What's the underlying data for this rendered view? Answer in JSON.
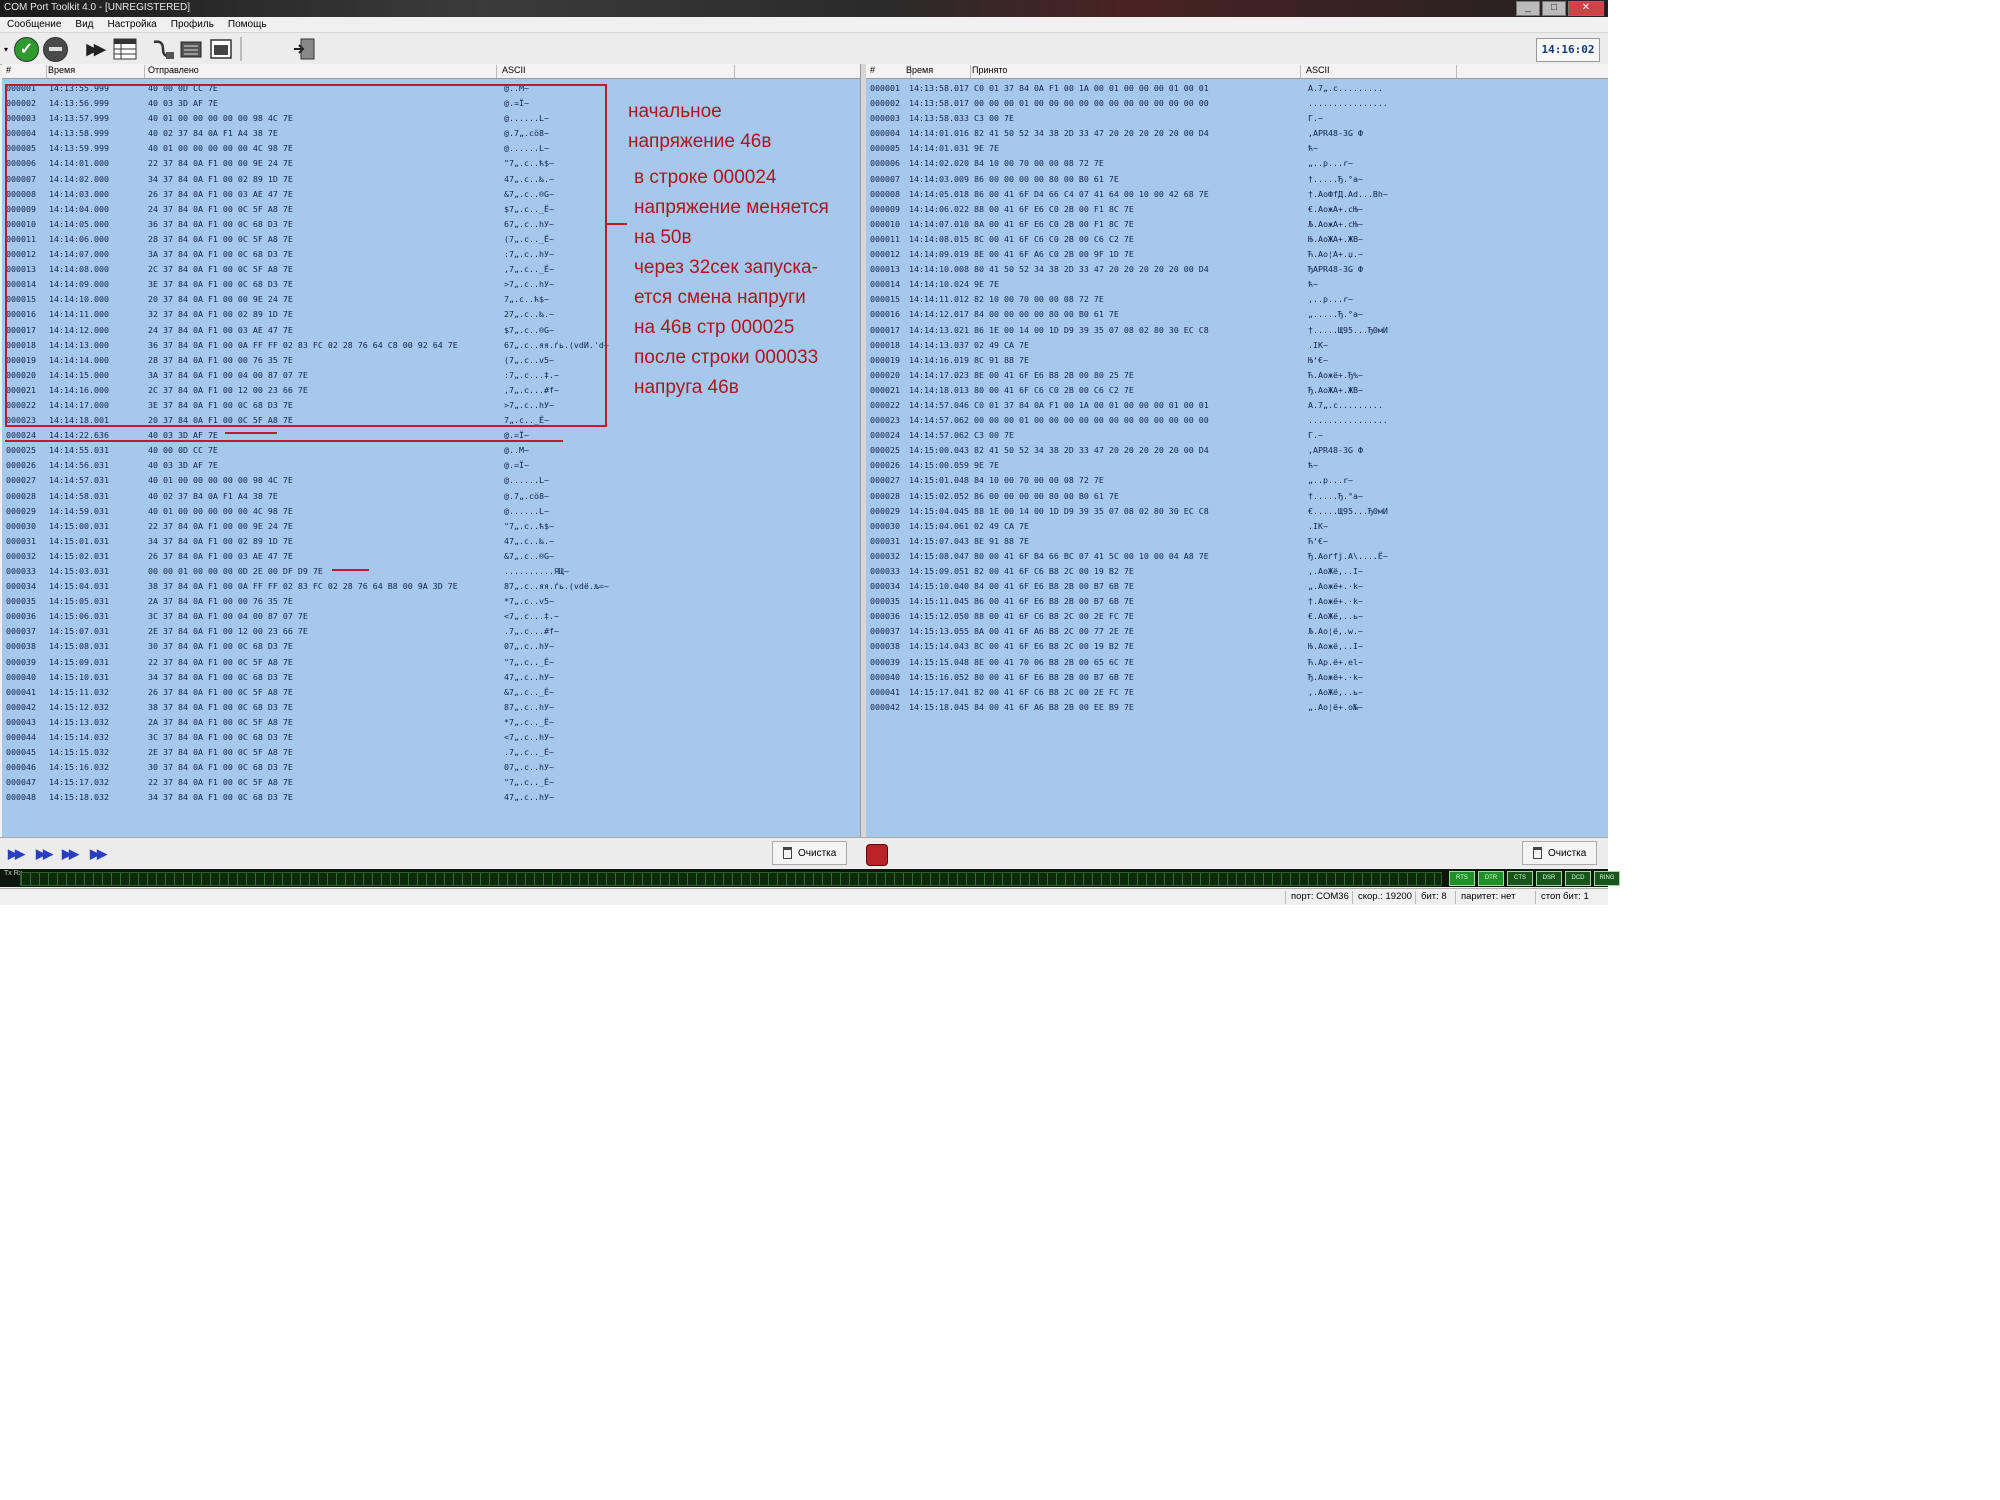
{
  "window": {
    "title": "COM Port Toolkit 4.0 - [UNREGISTERED]",
    "buttons": [
      "_",
      "□",
      "✕"
    ]
  },
  "menu": [
    "Сообщение",
    "Вид",
    "Настройка",
    "Профиль",
    "Помощь"
  ],
  "toolbar": {
    "clock": "14:16:02"
  },
  "left_panel": {
    "columns": [
      "#",
      "Время",
      "Отправлено",
      "ASCII"
    ],
    "rows": [
      [
        "000001",
        "14:13:55.999",
        "40 00 0D CC 7E",
        "@..М~"
      ],
      [
        "000002",
        "14:13:56.999",
        "40 03 3D AF 7E",
        "@.=Ї~"
      ],
      [
        "000003",
        "14:13:57.999",
        "40 01 00 00 00 00 00 98 4C 7E",
        "@......L~"
      ],
      [
        "000004",
        "14:13:58.999",
        "40 02 37 84 0A F1 A4 38 7E",
        "@.7„.сӧ8~"
      ],
      [
        "000005",
        "14:13:59.999",
        "40 01 00 00 00 00 00 4C 98 7E",
        "@......L~"
      ],
      [
        "000006",
        "14:14:01.000",
        "22 37 84 0A F1 00 00 9E 24 7E",
        "\"7„.с..ћ$~"
      ],
      [
        "000007",
        "14:14:02.000",
        "34 37 84 0A F1 00 02 89 1D 7E",
        "47„.с..‰.~"
      ],
      [
        "000008",
        "14:14:03.000",
        "26 37 84 0A F1 00 03 AE 47 7E",
        "&7„.с..®G~"
      ],
      [
        "000009",
        "14:14:04.000",
        "24 37 84 0A F1 00 0C 5F A8 7E",
        "$7„.с.._Ё~"
      ],
      [
        "000010",
        "14:14:05.000",
        "36 37 84 0A F1 00 0C 68 D3 7E",
        "67„.с..hУ~"
      ],
      [
        "000011",
        "14:14:06.000",
        "28 37 84 0A F1 00 0C 5F A8 7E",
        "(7„.с.._Ё~"
      ],
      [
        "000012",
        "14:14:07.000",
        "3A 37 84 0A F1 00 0C 68 D3 7E",
        ":7„.с..hУ~"
      ],
      [
        "000013",
        "14:14:08.000",
        "2C 37 84 0A F1 00 0C 5F A8 7E",
        ",7„.с.._Ё~"
      ],
      [
        "000014",
        "14:14:09.000",
        "3E 37 84 0A F1 00 0C 68 D3 7E",
        ">7„.с..hУ~"
      ],
      [
        "000015",
        "14:14:10.000",
        "20 37 84 0A F1 00 00 9E 24 7E",
        " 7„.с..ћ$~"
      ],
      [
        "000016",
        "14:14:11.000",
        "32 37 84 0A F1 00 02 89 1D 7E",
        "27„.с..‰.~"
      ],
      [
        "000017",
        "14:14:12.000",
        "24 37 84 0A F1 00 03 AE 47 7E",
        "$7„.с..®G~"
      ],
      [
        "000018",
        "14:14:13.000",
        "36 37 84 0A F1 00 0A FF FF 02 83 FC 02 28 76 64 C8 00 92 64 7E",
        "67„.с..яя.ѓь.(vdИ.'d~"
      ],
      [
        "000019",
        "14:14:14.000",
        "28 37 84 0A F1 00 00 76 35 7E",
        "(7„.с..v5~"
      ],
      [
        "000020",
        "14:14:15.000",
        "3A 37 84 0A F1 00 04 00 87 07 7E",
        ":7„.с...‡.~"
      ],
      [
        "000021",
        "14:14:16.000",
        "2C 37 84 0A F1 00 12 00 23 66 7E",
        ",7„.с...#f~"
      ],
      [
        "000022",
        "14:14:17.000",
        "3E 37 84 0A F1 00 0C 68 D3 7E",
        ">7„.с..hУ~"
      ],
      [
        "000023",
        "14:14:18.001",
        "20 37 84 0A F1 00 0C 5F A8 7E",
        " 7„.с.._Ё~"
      ],
      [
        "000024",
        "14:14:22.636",
        "40 03 3D AF 7E",
        "@.=Ї~"
      ],
      [
        "000025",
        "14:14:55.031",
        "40 00 0D CC 7E",
        "@..М~"
      ],
      [
        "000026",
        "14:14:56.031",
        "40 03 3D AF 7E",
        "@.=Ї~"
      ],
      [
        "000027",
        "14:14:57.031",
        "40 01 00 00 00 00 00 98 4C 7E",
        "@......L~"
      ],
      [
        "000028",
        "14:14:58.031",
        "40 02 37 84 0A F1 A4 38 7E",
        "@.7„.сӧ8~"
      ],
      [
        "000029",
        "14:14:59.031",
        "40 01 00 00 00 00 00 4C 98 7E",
        "@......L~"
      ],
      [
        "000030",
        "14:15:00.031",
        "22 37 84 0A F1 00 00 9E 24 7E",
        "\"7„.с..ћ$~"
      ],
      [
        "000031",
        "14:15:01.031",
        "34 37 84 0A F1 00 02 89 1D 7E",
        "47„.с..‰.~"
      ],
      [
        "000032",
        "14:15:02.031",
        "26 37 84 0A F1 00 03 AE 47 7E",
        "&7„.с..®G~"
      ],
      [
        "000033",
        "14:15:03.031",
        "00 00 01 00 00 00 0D 2E 00 DF D9 7E",
        "..........ЯЩ~"
      ],
      [
        "000034",
        "14:15:04.031",
        "38 37 84 0A F1 00 0A FF FF 02 83 FC 02 28 76 64 B8 00 9A 3D 7E",
        "87„.с..яя.ѓь.(vdё.љ=~"
      ],
      [
        "000035",
        "14:15:05.031",
        "2A 37 84 0A F1 00 00 76 35 7E",
        "*7„.с..v5~"
      ],
      [
        "000036",
        "14:15:06.031",
        "3C 37 84 0A F1 00 04 00 87 07 7E",
        "<7„.с...‡.~"
      ],
      [
        "000037",
        "14:15:07.031",
        "2E 37 84 0A F1 00 12 00 23 66 7E",
        ".7„.с...#f~"
      ],
      [
        "000038",
        "14:15:08.031",
        "30 37 84 0A F1 00 0C 68 D3 7E",
        "07„.с..hУ~"
      ],
      [
        "000039",
        "14:15:09.031",
        "22 37 84 0A F1 00 0C 5F A8 7E",
        "\"7„.с.._Ё~"
      ],
      [
        "000040",
        "14:15:10.031",
        "34 37 84 0A F1 00 0C 68 D3 7E",
        "47„.с..hУ~"
      ],
      [
        "000041",
        "14:15:11.032",
        "26 37 84 0A F1 00 0C 5F A8 7E",
        "&7„.с.._Ё~"
      ],
      [
        "000042",
        "14:15:12.032",
        "38 37 84 0A F1 00 0C 68 D3 7E",
        "87„.с..hУ~"
      ],
      [
        "000043",
        "14:15:13.032",
        "2A 37 84 0A F1 00 0C 5F A8 7E",
        "*7„.с.._Ё~"
      ],
      [
        "000044",
        "14:15:14.032",
        "3C 37 84 0A F1 00 0C 68 D3 7E",
        "<7„.с..hУ~"
      ],
      [
        "000045",
        "14:15:15.032",
        "2E 37 84 0A F1 00 0C 5F A8 7E",
        ".7„.с.._Ё~"
      ],
      [
        "000046",
        "14:15:16.032",
        "30 37 84 0A F1 00 0C 68 D3 7E",
        "07„.с..hУ~"
      ],
      [
        "000047",
        "14:15:17.032",
        "22 37 84 0A F1 00 0C 5F A8 7E",
        "\"7„.с.._Ё~"
      ],
      [
        "000048",
        "14:15:18.032",
        "34 37 84 0A F1 00 0C 68 D3 7E",
        "47„.с..hУ~"
      ]
    ]
  },
  "right_panel": {
    "columns": [
      "#",
      "Время",
      "Принято",
      "ASCII"
    ],
    "rows": [
      [
        "000001",
        "14:13:58.017",
        "C0 01 37 84 0A F1 00 1A 00 01 00 00 00 01 00 01",
        "А.7„.с........."
      ],
      [
        "000002",
        "14:13:58.017",
        "00 00 00 01 00 00 00 00 00 00 00 00 00 00 00 00",
        "................"
      ],
      [
        "000003",
        "14:13:58.033",
        "C3 00 7E",
        "Г.~"
      ],
      [
        "000004",
        "14:14:01.016",
        "82 41 50 52 34 38 2D 33 47 20 20 20 20 20 00 D4",
        "‚APR48-3G      Ф"
      ],
      [
        "000005",
        "14:14:01.031",
        "9E 7E",
        "ћ~"
      ],
      [
        "000006",
        "14:14:02.020",
        "84 10 00 70 00 00 08 72 7E",
        "„..p...r~"
      ],
      [
        "000007",
        "14:14:03.009",
        "86 00 00 00 00 80 00 B0 61 7E",
        "†.....Ђ.°a~"
      ],
      [
        "000008",
        "14:14:05.018",
        "86 00 41 6F D4 66 C4 07 41 64 00 10 00 42 68 7E",
        "†.AoФfД.Ad...Bh~"
      ],
      [
        "000009",
        "14:14:06.022",
        "88 00 41 6F E6 C0 2B 00 F1 8C 7E",
        "€.AoжА+.сЊ~"
      ],
      [
        "000010",
        "14:14:07.010",
        "8A 00 41 6F E6 C0 2B 00 F1 8C 7E",
        "Љ.AoжА+.сЊ~"
      ],
      [
        "000011",
        "14:14:08.015",
        "8C 00 41 6F C6 C0 2B 00 C6 C2 7E",
        "Њ.AoЖА+.ЖВ~"
      ],
      [
        "000012",
        "14:14:09.019",
        "8E 00 41 6F A6 C0 2B 00 9F 1D 7E",
        "Ћ.Ao¦А+.џ.~"
      ],
      [
        "000013",
        "14:14:10.008",
        "80 41 50 52 34 38 2D 33 47 20 20 20 20 20 00 D4",
        "ЂAPR48-3G      Ф"
      ],
      [
        "000014",
        "14:14:10.024",
        "9E 7E",
        "ћ~"
      ],
      [
        "000015",
        "14:14:11.012",
        "82 10 00 70 00 00 08 72 7E",
        "‚..p...r~"
      ],
      [
        "000016",
        "14:14:12.017",
        "84 00 00 00 00 80 00 B0 61 7E",
        "„.....Ђ.°a~"
      ],
      [
        "000017",
        "14:14:13.021",
        "86 1E 00 14 00 1D D9 39 35 07 08 02 80 30 EC C8",
        "†.....Щ95...Ђ0мИ"
      ],
      [
        "000018",
        "14:14:13.037",
        "02 49 CA 7E",
        ".IК~"
      ],
      [
        "000019",
        "14:14:16.019",
        "8C 91 88 7E",
        "Њ‘€~"
      ],
      [
        "000020",
        "14:14:17.023",
        "8E 00 41 6F E6 B8 2B 00 80 25 7E",
        "Ћ.Aoжё+.Ђ%~"
      ],
      [
        "000021",
        "14:14:18.013",
        "80 00 41 6F C6 C0 2B 00 C6 C2 7E",
        "Ђ.AoЖА+.ЖВ~"
      ],
      [
        "000022",
        "14:14:57.046",
        "C0 01 37 84 0A F1 00 1A 00 01 00 00 00 01 00 01",
        "А.7„.с........."
      ],
      [
        "000023",
        "14:14:57.062",
        "00 00 00 01 00 00 00 00 00 00 00 00 00 00 00 00",
        "................"
      ],
      [
        "000024",
        "14:14:57.062",
        "C3 00 7E",
        "Г.~"
      ],
      [
        "000025",
        "14:15:00.043",
        "82 41 50 52 34 38 2D 33 47 20 20 20 20 20 00 D4",
        "‚APR48-3G      Ф"
      ],
      [
        "000026",
        "14:15:00.059",
        "9E 7E",
        "ћ~"
      ],
      [
        "000027",
        "14:15:01.048",
        "84 10 00 70 00 00 08 72 7E",
        "„..p...r~"
      ],
      [
        "000028",
        "14:15:02.052",
        "86 00 00 00 00 80 00 B0 61 7E",
        "†.....Ђ.°a~"
      ],
      [
        "000029",
        "14:15:04.045",
        "88 1E 00 14 00 1D D9 39 35 07 08 02 80 30 EC C8",
        "€.....Щ95...Ђ0мИ"
      ],
      [
        "000030",
        "14:15:04.061",
        "02 49 CA 7E",
        ".IК~"
      ],
      [
        "000031",
        "14:15:07.043",
        "8E 91 88 7E",
        "Ћ‘€~"
      ],
      [
        "000032",
        "14:15:08.047",
        "80 00 41 6F B4 66 BC 07 41 5C 00 10 00 04 A8 7E",
        "Ђ.Aoґfј.A\\....Ё~"
      ],
      [
        "000033",
        "14:15:09.051",
        "82 00 41 6F C6 B8 2C 00 19 B2 7E",
        "‚.AoЖё,..І~"
      ],
      [
        "000034",
        "14:15:10.040",
        "84 00 41 6F E6 B8 2B 00 B7 6B 7E",
        "„.Aoжё+.·k~"
      ],
      [
        "000035",
        "14:15:11.045",
        "86 00 41 6F E6 B8 2B 00 B7 6B 7E",
        "†.Aoжё+.·k~"
      ],
      [
        "000036",
        "14:15:12.050",
        "88 00 41 6F C6 B8 2C 00 2E FC 7E",
        "€.AoЖё,..ь~"
      ],
      [
        "000037",
        "14:15:13.055",
        "8A 00 41 6F A6 B8 2C 00 77 2E 7E",
        "Љ.Ao¦ё,.w.~"
      ],
      [
        "000038",
        "14:15:14.043",
        "8C 00 41 6F E6 B8 2C 00 19 B2 7E",
        "Њ.Aoжё,..І~"
      ],
      [
        "000039",
        "14:15:15.048",
        "8E 00 41 70 06 B8 2B 00 65 6C 7E",
        "Ћ.Ap.ё+.el~"
      ],
      [
        "000040",
        "14:15:16.052",
        "80 00 41 6F E6 B8 2B 00 B7 6B 7E",
        "Ђ.Aoжё+.·k~"
      ],
      [
        "000041",
        "14:15:17.041",
        "82 00 41 6F C6 B8 2C 00 2E FC 7E",
        "‚.AoЖё,..ь~"
      ],
      [
        "000042",
        "14:15:18.045",
        "84 00 41 6F A6 B8 2B 00 EE B9 7E",
        "„.Ao¦ё+.о№~"
      ]
    ]
  },
  "annotation": {
    "lines": [
      "начальное",
      "напряжение 46в",
      "в строке 000024",
      "напряжение меняется",
      "на 50в",
      "через 32сек запуска-",
      "ется смена напруги",
      "на 46в стр 000025",
      "после строки 000033",
      "напруга 46в"
    ],
    "color": "#b0141c"
  },
  "bottom": {
    "clear_left": "Очистка",
    "clear_right": "Очистка",
    "txrx_label": "Tx Rx",
    "leds": [
      "RTS",
      "DTR",
      "CTS",
      "DSR",
      "DCD",
      "RING"
    ]
  },
  "statusbar": {
    "port": "порт: COM36",
    "speed": "скор.: 19200",
    "bits": "бит: 8",
    "parity": "паритет: нет",
    "stop": "стоп бит: 1"
  }
}
